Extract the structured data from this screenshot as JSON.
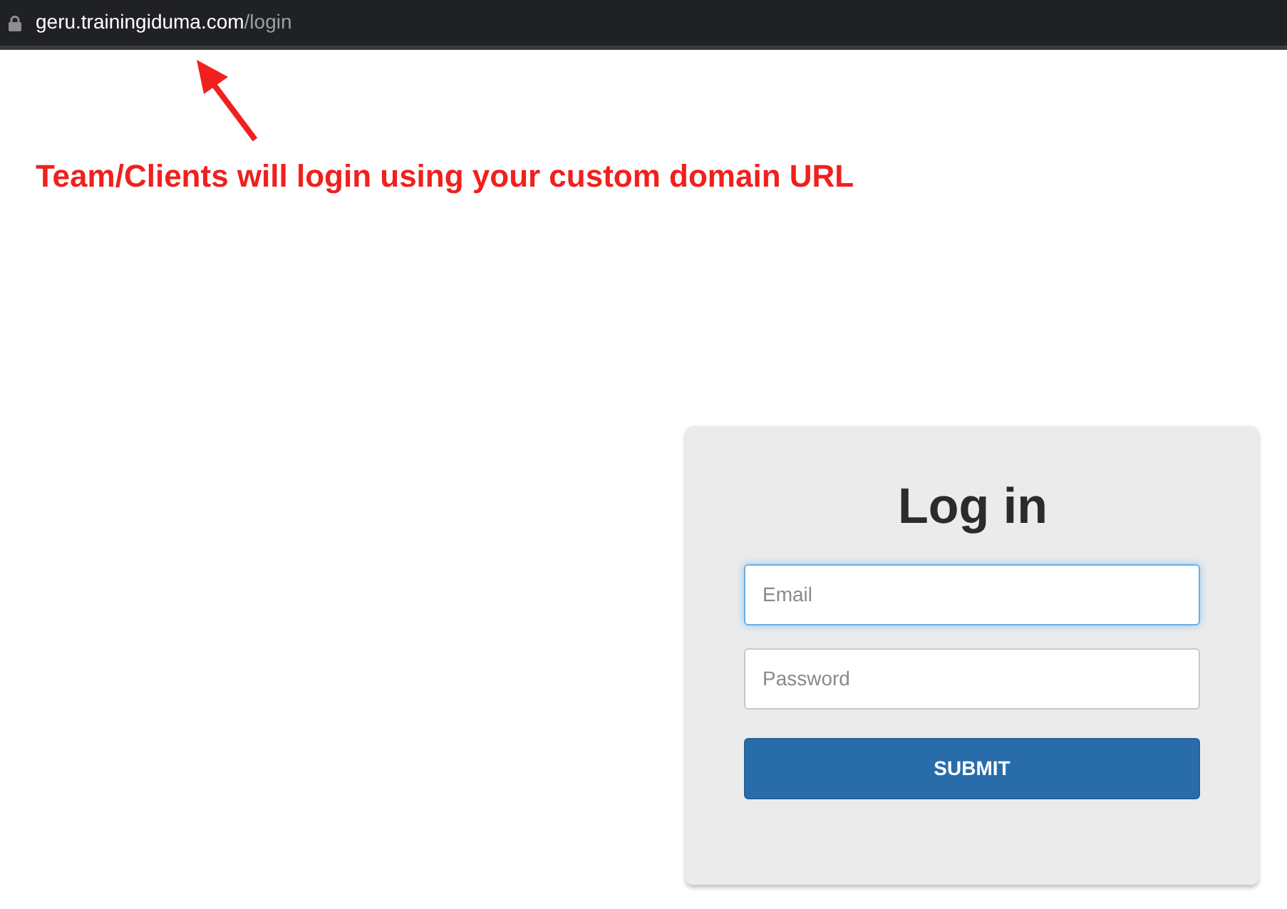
{
  "address_bar": {
    "host": "geru.trainingiduma.com",
    "path": "/login"
  },
  "annotation": {
    "text": "Team/Clients will login using your custom domain URL"
  },
  "login_form": {
    "title": "Log in",
    "fields": [
      {
        "placeholder": "Email",
        "focused": true
      },
      {
        "placeholder": "Password",
        "focused": false
      }
    ],
    "submit_button": "SUBMIT"
  }
}
